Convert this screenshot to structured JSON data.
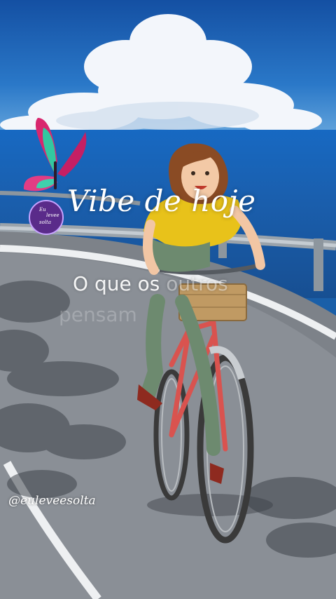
{
  "overlay": {
    "title": "Vibe de hoje",
    "subtitle_main": "O que os ",
    "subtitle_fade": "outros",
    "subtitle_ghost": "pensam",
    "handle": "@euleveesolta"
  },
  "logo": {
    "seal_line_1": "Eu",
    "seal_line_2": "levee",
    "seal_line_3": "solta"
  },
  "colors": {
    "sky": "#1a5fa8",
    "sea": "#1a5fae",
    "shirt": "#e8c21a",
    "bicycle": "#d9534f",
    "basket": "#b58b55"
  }
}
